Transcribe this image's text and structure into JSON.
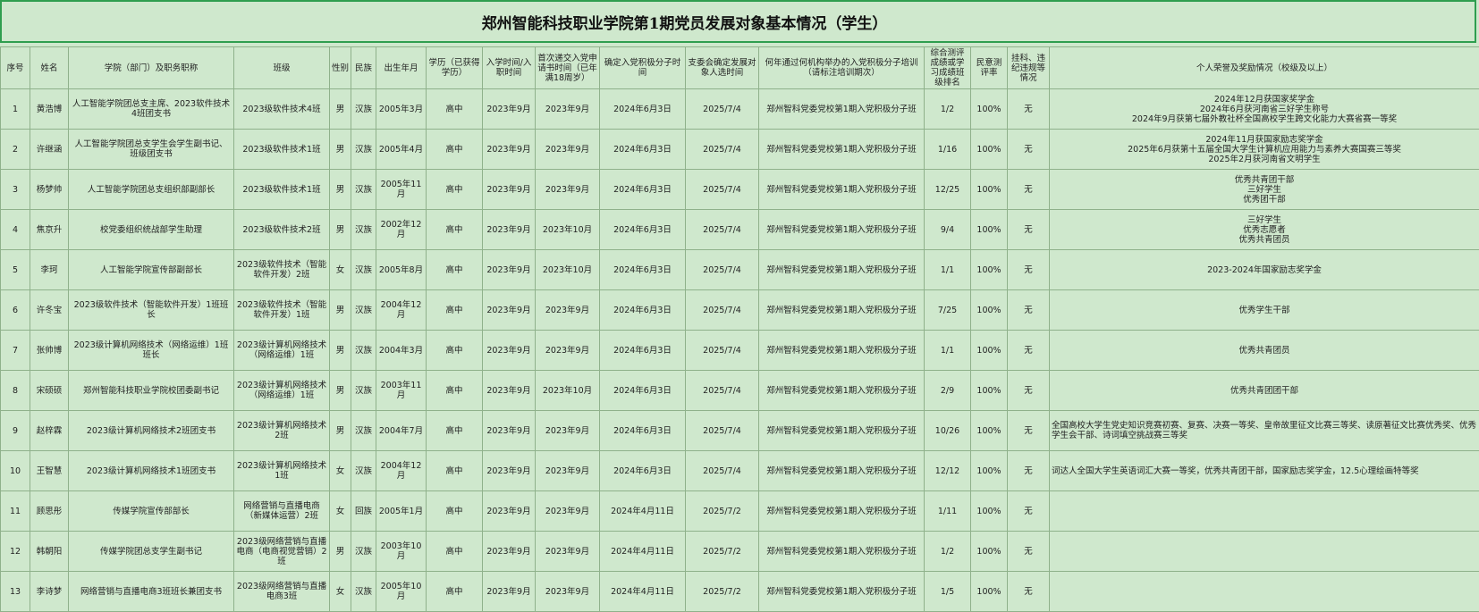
{
  "title": "郑州智能科技职业学院第1期党员发展对象基本情况（学生）",
  "headers": [
    "序号",
    "姓名",
    "学院（部门）及职务职称",
    "班级",
    "性别",
    "民族",
    "出生年月",
    "学历（已获得学历）",
    "入学时间/入职时间",
    "首次递交入党申请书时间（已年满18周岁）",
    "确定入党积极分子时间",
    "支委会确定发展对象人选时间",
    "何年通过何机构举办的入党积极分子培训（请标注培训期次）",
    "综合测评成绩或学习成绩班级排名",
    "民意测评率",
    "挂科、违纪违规等情况",
    "个人荣誉及奖励情况（校级及以上）"
  ],
  "rows": [
    {
      "no": "1",
      "name": "黄浩博",
      "dept": "人工智能学院团总支主席、2023软件技术4班团支书",
      "class": "2023级软件技术4班",
      "gender": "男",
      "ethnic": "汉族",
      "birth": "2005年3月",
      "edu": "高中",
      "enroll": "2023年9月",
      "apply": "2023年9月",
      "activist": "2024年6月3日",
      "candidate": "2025/7/4",
      "training": "郑州智科党委党校第1期入党积极分子班",
      "rank": "1/2",
      "poll": "100%",
      "issues": "无",
      "awards": [
        "2024年12月获国家奖学金",
        "2024年6月获河南省三好学生称号",
        "2024年9月获第七届外教社杯全国高校学生跨文化能力大赛省赛一等奖"
      ]
    },
    {
      "no": "2",
      "name": "许继涵",
      "dept": "人工智能学院团总支学生会学生副书记、班级团支书",
      "class": "2023级软件技术1班",
      "gender": "男",
      "ethnic": "汉族",
      "birth": "2005年4月",
      "edu": "高中",
      "enroll": "2023年9月",
      "apply": "2023年9月",
      "activist": "2024年6月3日",
      "candidate": "2025/7/4",
      "training": "郑州智科党委党校第1期入党积极分子班",
      "rank": "1/16",
      "poll": "100%",
      "issues": "无",
      "awards": [
        "2024年11月获国家励志奖学金",
        "2025年6月获第十五届全国大学生计算机应用能力与素养大赛国赛三等奖",
        "2025年2月获河南省文明学生"
      ]
    },
    {
      "no": "3",
      "name": "杨梦帅",
      "dept": "人工智能学院团总支组织部副部长",
      "class": "2023级软件技术1班",
      "gender": "男",
      "ethnic": "汉族",
      "birth": "2005年11月",
      "edu": "高中",
      "enroll": "2023年9月",
      "apply": "2023年9月",
      "activist": "2024年6月3日",
      "candidate": "2025/7/4",
      "training": "郑州智科党委党校第1期入党积极分子班",
      "rank": "12/25",
      "poll": "100%",
      "issues": "无",
      "awards": [
        "优秀共青团干部",
        "三好学生",
        "优秀团干部"
      ]
    },
    {
      "no": "4",
      "name": "焦京升",
      "dept": "校党委组织统战部学生助理",
      "class": "2023级软件技术2班",
      "gender": "男",
      "ethnic": "汉族",
      "birth": "2002年12月",
      "edu": "高中",
      "enroll": "2023年9月",
      "apply": "2023年10月",
      "activist": "2024年6月3日",
      "candidate": "2025/7/4",
      "training": "郑州智科党委党校第1期入党积极分子班",
      "rank": "9/4",
      "poll": "100%",
      "issues": "无",
      "awards": [
        "三好学生",
        "优秀志愿者",
        "优秀共青团员"
      ]
    },
    {
      "no": "5",
      "name": "李珂",
      "dept": "人工智能学院宣传部副部长",
      "class": "2023级软件技术（智能软件开发）2班",
      "gender": "女",
      "ethnic": "汉族",
      "birth": "2005年8月",
      "edu": "高中",
      "enroll": "2023年9月",
      "apply": "2023年10月",
      "activist": "2024年6月3日",
      "candidate": "2025/7/4",
      "training": "郑州智科党委党校第1期入党积极分子班",
      "rank": "1/1",
      "poll": "100%",
      "issues": "无",
      "awards": [
        "2023-2024年国家励志奖学金"
      ]
    },
    {
      "no": "6",
      "name": "许冬宝",
      "dept": "2023级软件技术（智能软件开发）1班班长",
      "class": "2023级软件技术（智能软件开发）1班",
      "gender": "男",
      "ethnic": "汉族",
      "birth": "2004年12月",
      "edu": "高中",
      "enroll": "2023年9月",
      "apply": "2023年9月",
      "activist": "2024年6月3日",
      "candidate": "2025/7/4",
      "training": "郑州智科党委党校第1期入党积极分子班",
      "rank": "7/25",
      "poll": "100%",
      "issues": "无",
      "awards": [
        "优秀学生干部"
      ]
    },
    {
      "no": "7",
      "name": "张帅博",
      "dept": "2023级计算机网络技术（网络运维）1班班长",
      "class": "2023级计算机网络技术（网络运维）1班",
      "gender": "男",
      "ethnic": "汉族",
      "birth": "2004年3月",
      "edu": "高中",
      "enroll": "2023年9月",
      "apply": "2023年9月",
      "activist": "2024年6月3日",
      "candidate": "2025/7/4",
      "training": "郑州智科党委党校第1期入党积极分子班",
      "rank": "1/1",
      "poll": "100%",
      "issues": "无",
      "awards": [
        "优秀共青团员"
      ]
    },
    {
      "no": "8",
      "name": "宋硕硕",
      "dept": "郑州智能科技职业学院校团委副书记",
      "class": "2023级计算机网络技术（网络运维）1班",
      "gender": "男",
      "ethnic": "汉族",
      "birth": "2003年11月",
      "edu": "高中",
      "enroll": "2023年9月",
      "apply": "2023年10月",
      "activist": "2024年6月3日",
      "candidate": "2025/7/4",
      "training": "郑州智科党委党校第1期入党积极分子班",
      "rank": "2/9",
      "poll": "100%",
      "issues": "无",
      "awards": [
        "优秀共青团团干部"
      ]
    },
    {
      "no": "9",
      "name": "赵梓霖",
      "dept": "2023级计算机网络技术2班团支书",
      "class": "2023级计算机网络技术2班",
      "gender": "男",
      "ethnic": "汉族",
      "birth": "2004年7月",
      "edu": "高中",
      "enroll": "2023年9月",
      "apply": "2023年9月",
      "activist": "2024年6月3日",
      "candidate": "2025/7/4",
      "training": "郑州智科党委党校第1期入党积极分子班",
      "rank": "10/26",
      "poll": "100%",
      "issues": "无",
      "awards": [
        "全国高校大学生党史知识竞赛初赛、复赛、决赛一等奖、皇帝故里征文比赛三等奖、读原著征文比赛优秀奖、优秀学生会干部、诗词填空挑战赛三等奖"
      ],
      "awardsWrap": true
    },
    {
      "no": "10",
      "name": "王智慧",
      "dept": "2023级计算机网络技术1班团支书",
      "class": "2023级计算机网络技术1班",
      "gender": "女",
      "ethnic": "汉族",
      "birth": "2004年12月",
      "edu": "高中",
      "enroll": "2023年9月",
      "apply": "2023年9月",
      "activist": "2024年6月3日",
      "candidate": "2025/7/4",
      "training": "郑州智科党委党校第1期入党积极分子班",
      "rank": "12/12",
      "poll": "100%",
      "issues": "无",
      "awards": [
        "词达人全国大学生英语词汇大赛一等奖，优秀共青团干部，国家励志奖学金，12.5心理绘画特等奖"
      ],
      "awardsWrap": true
    },
    {
      "no": "11",
      "name": "顾思彤",
      "dept": "传媒学院宣传部部长",
      "class": "网络营销与直播电商（新媒体运营）2班",
      "gender": "女",
      "ethnic": "回族",
      "birth": "2005年1月",
      "edu": "高中",
      "enroll": "2023年9月",
      "apply": "2023年9月",
      "activist": "2024年4月11日",
      "candidate": "2025/7/2",
      "training": "郑州智科党委党校第1期入党积极分子班",
      "rank": "1/11",
      "poll": "100%",
      "issues": "无",
      "awards": []
    },
    {
      "no": "12",
      "name": "韩朝阳",
      "dept": "传媒学院团总支学生副书记",
      "class": "2023级网络营销与直播电商（电商视觉营销）2班",
      "gender": "男",
      "ethnic": "汉族",
      "birth": "2003年10月",
      "edu": "高中",
      "enroll": "2023年9月",
      "apply": "2023年9月",
      "activist": "2024年4月11日",
      "candidate": "2025/7/2",
      "training": "郑州智科党委党校第1期入党积极分子班",
      "rank": "1/2",
      "poll": "100%",
      "issues": "无",
      "awards": []
    },
    {
      "no": "13",
      "name": "李诗梦",
      "dept": "网络营销与直播电商3班班长兼团支书",
      "class": "2023级网络营销与直播电商3班",
      "gender": "女",
      "ethnic": "汉族",
      "birth": "2005年10月",
      "edu": "高中",
      "enroll": "2023年9月",
      "apply": "2023年9月",
      "activist": "2024年4月11日",
      "candidate": "2025/7/2",
      "training": "郑州智科党委党校第1期入党积极分子班",
      "rank": "1/5",
      "poll": "100%",
      "issues": "无",
      "awards": []
    }
  ]
}
